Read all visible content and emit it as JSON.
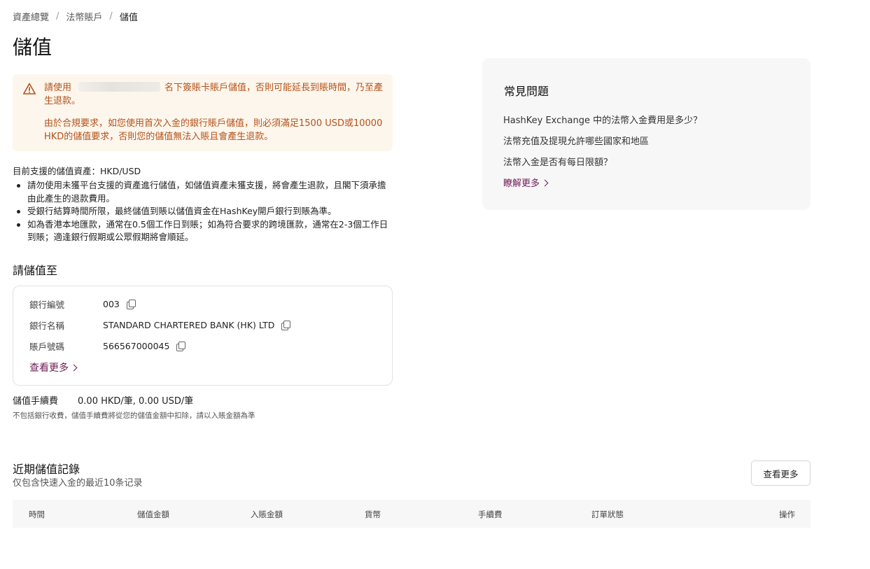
{
  "breadcrumb": {
    "items": [
      "資產總覽",
      "法幣賬戶",
      "儲值"
    ],
    "separator": "/"
  },
  "page_title": "儲值",
  "warning": {
    "line1_before": "請使用",
    "line1_after": "名下簽賬卡賬戶儲值，否則可能延長到賬時間，乃至產生退款。",
    "line2": "由於合規要求，如您使用首次入金的銀行賬戶儲值，則必須滿足1500 USD或10000 HKD的儲值要求，否則您的儲值無法入賬且會產生退款。"
  },
  "supported_assets": "目前支援的儲值資產：HKD/USD",
  "bullets": [
    "請勿使用未獲平台支援的資產進行儲值，如儲值資產未獲支援，將會產生退款，且閣下須承擔由此產生的退款費用。",
    "受銀行結算時間所限，最終儲值到賬以儲值資金在HashKey開戶銀行到賬為準。",
    "如為香港本地匯款，通常在0.5個工作日到賬；如為符合要求的跨境匯款，通常在2-3個工作日到賬；適逢銀行假期或公眾假期將會順延。"
  ],
  "deposit_to": {
    "title": "請儲值至",
    "rows": [
      {
        "label": "銀行編號",
        "value": "003"
      },
      {
        "label": "銀行名稱",
        "value": "STANDARD CHARTERED BANK (HK) LTD"
      },
      {
        "label": "賬戶號碼",
        "value": "566567000045"
      }
    ],
    "see_more": "查看更多"
  },
  "fee": {
    "label": "儲值手續費",
    "value": "0.00 HKD/筆, 0.00 USD/筆",
    "note": "不包括銀行收費，儲值手續費將從您的儲值金額中扣除，請以入賬金額為準"
  },
  "faq": {
    "title": "常見問題",
    "questions": [
      "HashKey Exchange 中的法幣入金費用是多少？",
      "法幣充值及提現允許哪些國家和地區",
      "法幣入金是否有每日限額？"
    ],
    "more": "瞭解更多"
  },
  "recent": {
    "title": "近期儲值記錄",
    "subtitle": "仅包含快速入金的最近10条记录",
    "view_more": "查看更多",
    "columns": [
      "時間",
      "儲值金額",
      "入賬金額",
      "貨幣",
      "手續費",
      "訂單狀態",
      "操作"
    ]
  },
  "colors": {
    "accent": "#6e1b55",
    "warning_text": "#b4521b",
    "warning_bg": "#fdf6ec",
    "panel_bg": "#f7f7f8"
  },
  "icons": {
    "warning": "warning-triangle-icon",
    "copy": "copy-icon",
    "chevron": "chevron-right-icon"
  }
}
